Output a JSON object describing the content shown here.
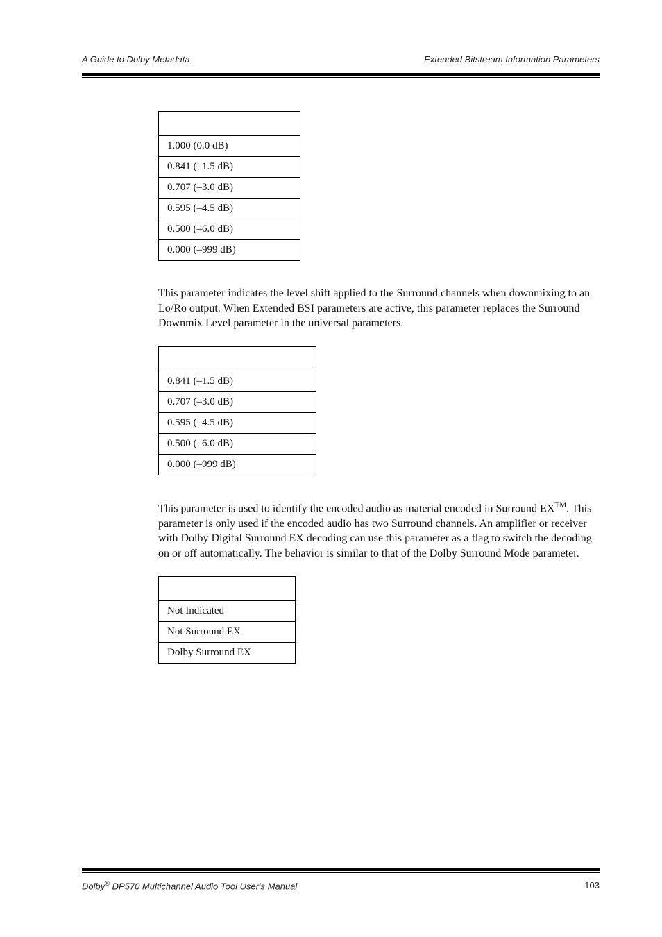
{
  "header": {
    "left": "A Guide to Dolby Metadata",
    "right": "Extended Bitstream Information Parameters"
  },
  "tables": {
    "t1": {
      "header": "",
      "rows": [
        "1.000 (0.0 dB)",
        "0.841 (–1.5 dB)",
        "0.707 (–3.0 dB)",
        "0.595 (–4.5 dB)",
        "0.500 (–6.0 dB)",
        "0.000 (–999 dB)"
      ]
    },
    "t2": {
      "header": "",
      "rows": [
        "0.841 (–1.5 dB)",
        "0.707 (–3.0 dB)",
        "0.595 (–4.5 dB)",
        "0.500 (–6.0 dB)",
        "0.000 (–999 dB)"
      ]
    },
    "t3": {
      "header": "",
      "rows": [
        "Not Indicated",
        "Not Surround EX",
        "Dolby Surround EX"
      ]
    }
  },
  "paragraphs": {
    "p1": "This parameter indicates the level shift applied to the Surround channels when downmixing to an Lo/Ro output. When Extended BSI parameters are active, this parameter replaces the Surround Downmix Level parameter in the universal parameters.",
    "p2a": "This parameter is used to identify the encoded audio as material encoded in Surround EX",
    "p2b": ". This parameter is only used if the encoded audio has two Surround channels. An amplifier or receiver with Dolby Digital Surround EX decoding can use this parameter as a flag to switch the decoding on or off automatically. The behavior is similar to that of the Dolby Surround Mode parameter.",
    "tm": "TM"
  },
  "footer": {
    "left_prefix": "Dolby",
    "reg": "®",
    "left_suffix": " DP570 Multichannel Audio Tool User's Manual",
    "page": "103"
  }
}
